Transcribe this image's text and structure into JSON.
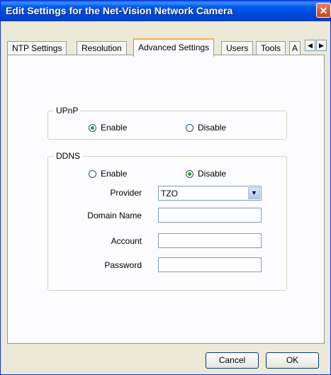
{
  "window": {
    "title": "Edit Settings for the Net-Vision Network Camera",
    "close_icon": "close-icon"
  },
  "tabs": [
    {
      "label": "NTP Settings"
    },
    {
      "label": "Resolution"
    },
    {
      "label": "Advanced Settings",
      "active": true
    },
    {
      "label": "Users"
    },
    {
      "label": "Tools"
    },
    {
      "label": "A"
    }
  ],
  "tab_scroll": {
    "left": "◀",
    "right": "▶"
  },
  "upnp": {
    "title": "UPnP",
    "enable_label": "Enable",
    "disable_label": "Disable",
    "selected": "enable"
  },
  "ddns": {
    "title": "DDNS",
    "enable_label": "Enable",
    "disable_label": "Disable",
    "selected": "disable",
    "provider_label": "Provider",
    "provider_value": "TZO",
    "domain_label": "Domain Name",
    "domain_value": "",
    "account_label": "Account",
    "account_value": "",
    "password_label": "Password",
    "password_value": ""
  },
  "buttons": {
    "cancel": "Cancel",
    "ok": "OK"
  },
  "colors": {
    "titlebar": "#0058ee",
    "face": "#ece9d8",
    "active_tab_accent": "#f7b444",
    "radio_dot": "#21a121"
  }
}
